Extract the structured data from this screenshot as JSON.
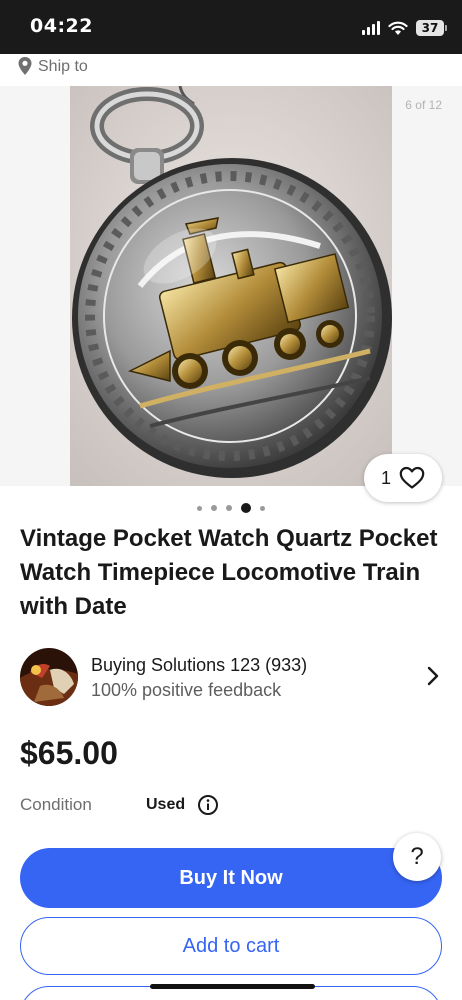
{
  "status_bar": {
    "time": "04:22",
    "battery": "37"
  },
  "ship": {
    "label": "Ship to"
  },
  "gallery": {
    "counter": "6 of 12",
    "image_alt": "Silver and gold pocket watch engraved with a locomotive train",
    "dots": 5,
    "active_dot": 3
  },
  "watch": {
    "likes": "1"
  },
  "product": {
    "title": "Vintage Pocket Watch Quartz Pocket Watch Timepiece Locomotive Train with Date"
  },
  "seller": {
    "name": "Buying Solutions 123 (933)",
    "feedback": "100% positive feedback"
  },
  "price": "$65.00",
  "condition": {
    "label": "Condition",
    "value": "Used"
  },
  "help": {
    "symbol": "?"
  },
  "actions": {
    "buy_now": "Buy It Now",
    "add_to_cart": "Add to cart"
  },
  "colors": {
    "primary": "#3665f3",
    "text": "#191919",
    "muted": "#6e6e6e"
  }
}
